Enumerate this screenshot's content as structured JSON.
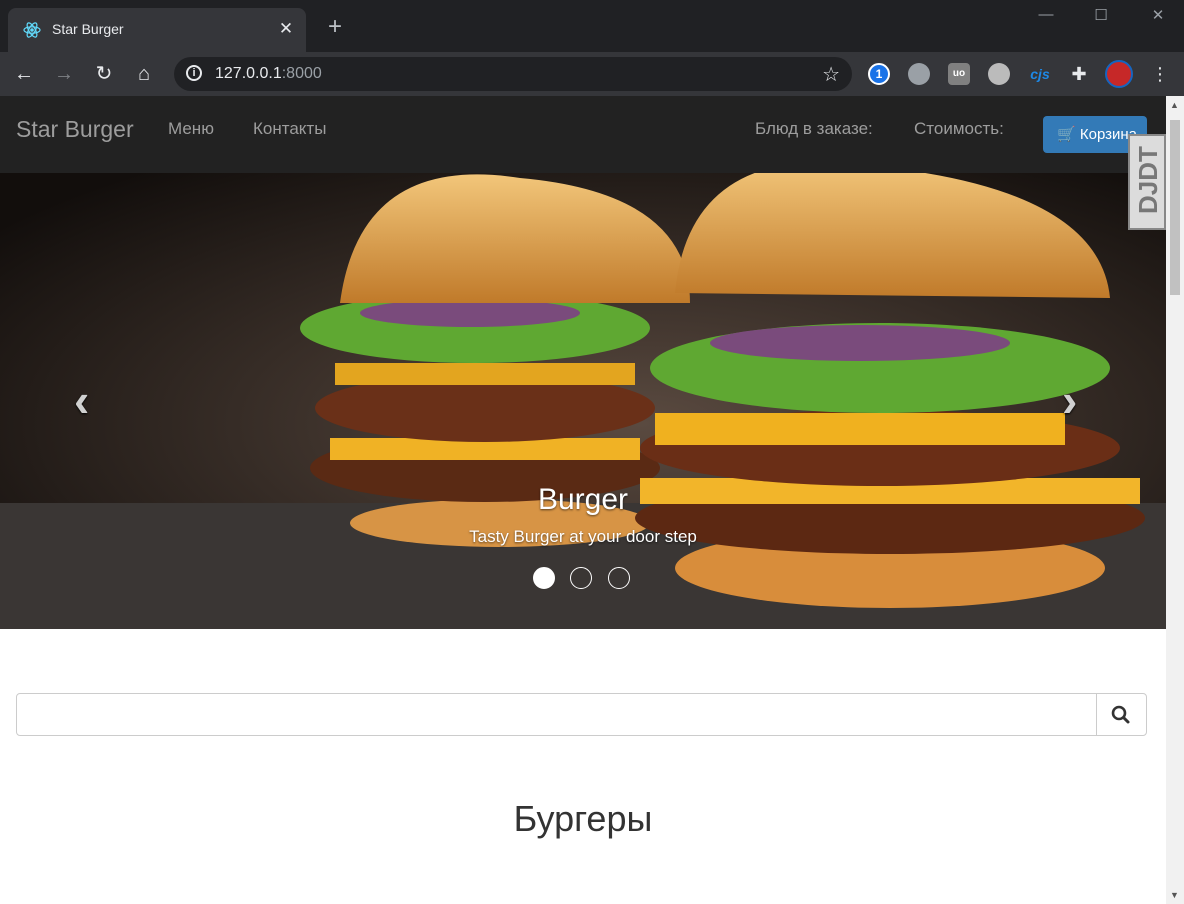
{
  "browser": {
    "tab_title": "Star Burger",
    "tab_close": "✕",
    "new_tab": "+",
    "url_host": "127.0.0.1",
    "url_port": ":8000",
    "window_controls": {
      "minimize": "—",
      "maximize": "☐",
      "close": "✕"
    },
    "extensions": [
      {
        "name": "onepassword-icon",
        "label": "1",
        "color": "#1a73e8"
      },
      {
        "name": "globe-icon",
        "label": "",
        "color": "#9aa0a6"
      },
      {
        "name": "ublock-icon",
        "label": "uo",
        "color": "#808080"
      },
      {
        "name": "ghostery-icon",
        "label": "",
        "color": "#bbbbbb"
      },
      {
        "name": "cjs-icon",
        "label": "cjs",
        "color": "#1e88e5"
      },
      {
        "name": "puzzle-icon",
        "label": "",
        "color": "#e8eaed"
      },
      {
        "name": "avatar",
        "label": "",
        "color": "#c62828"
      }
    ]
  },
  "navbar": {
    "brand": "Star Burger",
    "links": [
      "Меню",
      "Контакты"
    ],
    "order_items_label": "Блюд в заказе:",
    "cost_label": "Стоимость:",
    "cart_button": "Корзина",
    "debug_toolbar": "DJDT"
  },
  "carousel": {
    "title": "Burger",
    "subtitle": "Tasty Burger at your door step",
    "prev_icon": "‹",
    "next_icon": "›",
    "slides": 3,
    "active_slide": 0
  },
  "search": {
    "value": "",
    "placeholder": ""
  },
  "section_heading": "Бургеры"
}
